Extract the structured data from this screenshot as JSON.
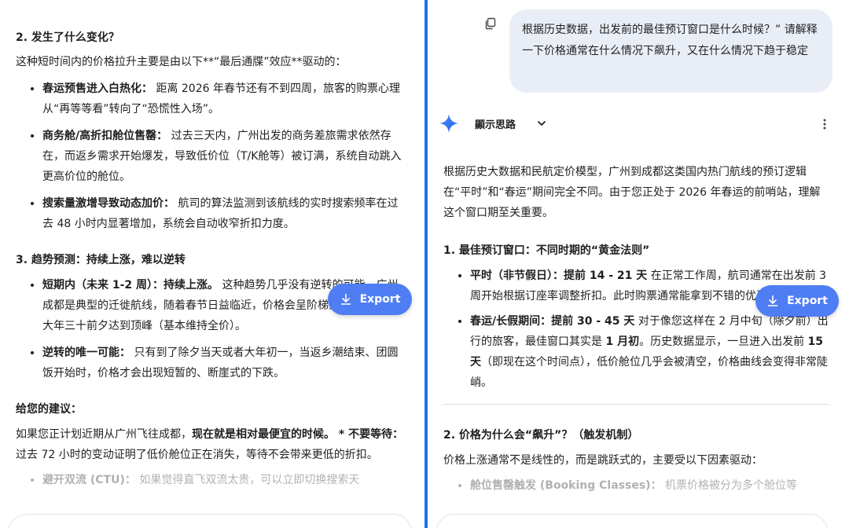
{
  "left": {
    "s2_heading": "2. 发生了什么变化？",
    "s2_intro": "这种短时间内的价格拉升主要是由以下**“最后通牒”效应**驱动的：",
    "s2_items": [
      {
        "bold": "春运预售进入白热化：",
        "text": " 距离 2026 年春节还有不到四周，旅客的购票心理从“再等等看”转向了“恐慌性入场”。"
      },
      {
        "bold": "商务舱/高折扣舱位售罄：",
        "text": " 过去三天内，广州出发的商务差旅需求依然存在，而返乡需求开始爆发，导致低价位（T/K舱等）被订满，系统自动跳入更高价位的舱位。"
      },
      {
        "bold": "搜索量激增导致动态加价：",
        "text": " 航司的算法监测到该航线的实时搜索频率在过去 48 小时内显著增加，系统会自动收窄折扣力度。"
      }
    ],
    "s3_heading": "3. 趋势预测：持续上涨，难以逆转",
    "s3_items": [
      {
        "bold": "短期内（未来 1-2 周）：持续上涨。",
        "text": " 这种趋势几乎没有逆转的可能。广州-成都是典型的迁徙航线，随着春节日益临近，价格会呈阶梯式直攀升，直到大年三十前夕达到顶峰（基本维持全价）。"
      },
      {
        "bold": "逆转的唯一可能：",
        "text": " 只有到了除夕当天或者大年初一，当返乡潮结束、团圆饭开始时，价格才会出现短暂的、断崖式的下跌。"
      }
    ],
    "advice_heading": "给您的建议：",
    "advice_lead": "如果您正计划近期从广州飞往成都，",
    "advice_bold1": "现在就是相对最便宜的时候。",
    "advice_bold2": " * 不要等待：",
    "advice_tail": " 过去 72 小时的变动证明了低价舱位正在消失，等待不会带来更低的折扣。",
    "cut_bold": "避开双流 (CTU)：",
    "cut_text": " 如果觉得直飞双流太贵，可以立即切换搜索天"
  },
  "right": {
    "user_message": "根据历史数据，出发前的最佳预订窗口是什么时候？” 请解释一下价格通常在什么情况下飙升，又在什么情况下趋于稳定",
    "thinking_label": "顯示思路",
    "intro": "根据历史大数据和民航定价模型，广州到成都这类国内热门航线的预订逻辑在“平时”和“春运”期间完全不同。由于您正处于 2026 年春运的前哨站，理解这个窗口期至关重要。",
    "s1_heading": "1. 最佳预订窗口：不同时期的“黄金法则”",
    "s1_item1_bold": "平时（非节假日）：提前 14 - 21 天",
    "s1_item1_text": " 在正常工作周，航司通常在出发前 3 周开始根据订座率调整折扣。此时购票通常能拿到不错的优惠。",
    "s1_item2_bold": "春运/长假期间：提前 30 - 45 天",
    "s1_item2_text_a": " 对于像您这样在 2 月中旬（除夕前）出行的旅客，最佳窗口其实是 ",
    "s1_item2_bold2": "1 月初",
    "s1_item2_text_b": "。历史数据显示，一旦进入出发前 ",
    "s1_item2_bold3": "15 天",
    "s1_item2_text_c": "（即现在这个时间点），低价舱位几乎会被清空，价格曲线会变得非常陡峭。",
    "s2_heading": "2. 价格为什么会“飙升”？（触发机制）",
    "s2_intro": "价格上涨通常不是线性的，而是跳跃式的，主要受以下因素驱动：",
    "cut_bold": "舱位售罄触发 (Booking Classes)：",
    "cut_text": " 机票价格被分为多个舱位等"
  },
  "export_label": "Export",
  "colors": {
    "accent": "#1a73e8",
    "export_bg": "#4f7df3",
    "bubble_bg": "#e9eef6"
  },
  "icons": {
    "copy": "copy-icon",
    "spark": "gemini-spark-icon",
    "chevron": "chevron-down-icon",
    "more": "more-vert-icon",
    "download": "download-icon"
  }
}
